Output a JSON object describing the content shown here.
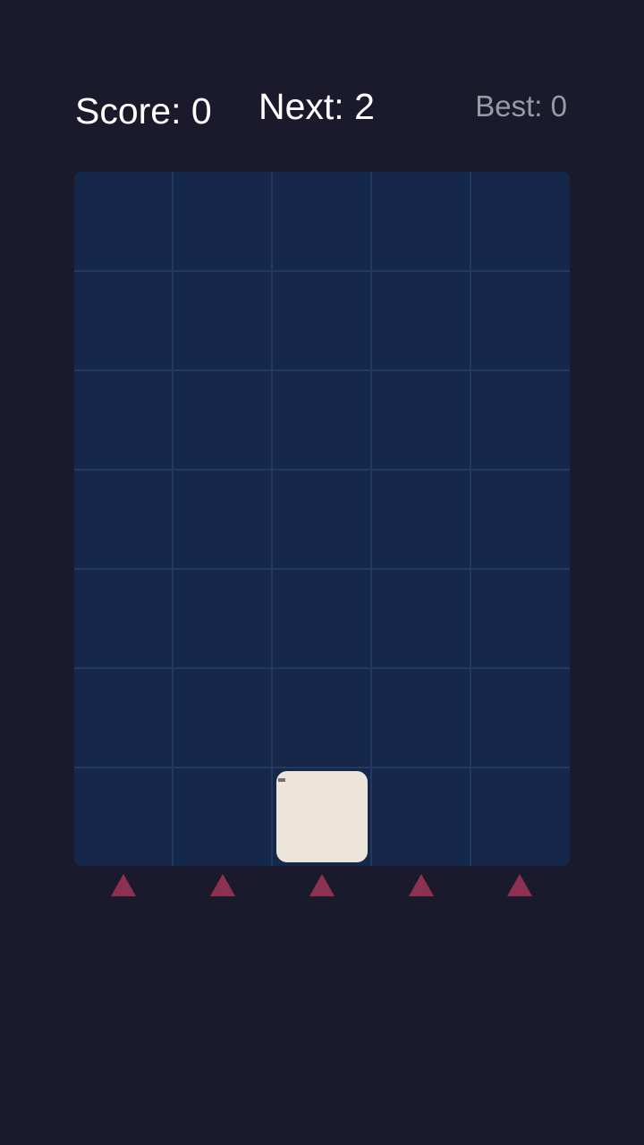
{
  "hud": {
    "score_label": "Score: 0",
    "next_label": "Next: 2",
    "best_label": "Best: 0"
  },
  "board": {
    "columns": 5,
    "rows": 7,
    "tiles": [
      {
        "column": 3,
        "row": 7,
        "value": ""
      }
    ]
  },
  "drop_controls": [
    {
      "column": 1,
      "icon": "triangle-up-icon"
    },
    {
      "column": 2,
      "icon": "triangle-up-icon"
    },
    {
      "column": 3,
      "icon": "triangle-up-icon"
    },
    {
      "column": 4,
      "icon": "triangle-up-icon"
    },
    {
      "column": 5,
      "icon": "triangle-up-icon"
    }
  ],
  "colors": {
    "background": "#1b1a2c",
    "board": "#15284a",
    "grid_line": "#233a5e",
    "tile": "#ede4da",
    "arrow": "#8e3150",
    "text_primary": "#ffffff",
    "text_secondary": "#9a9aa3"
  }
}
